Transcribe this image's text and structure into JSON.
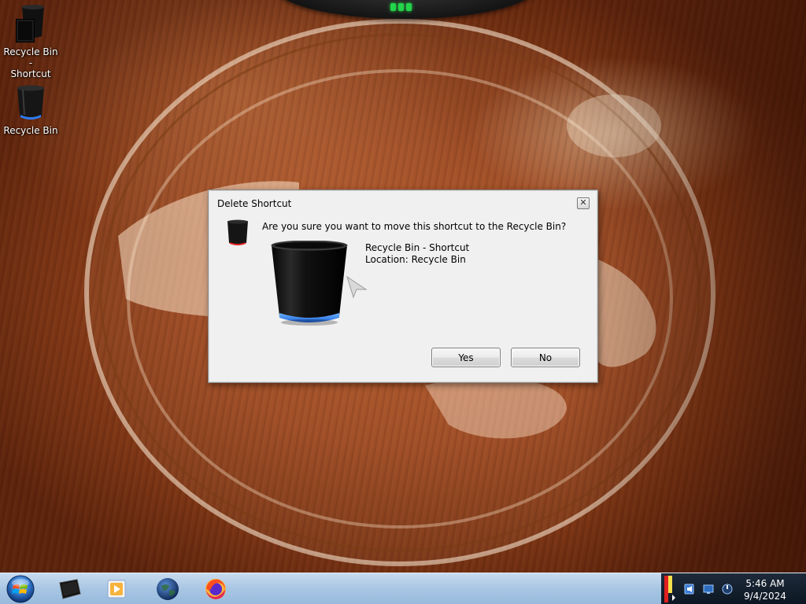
{
  "desktop": {
    "icons": [
      {
        "label_line1": "Recycle Bin -",
        "label_line2": "Shortcut",
        "icon": "recycle-bin-shortcut-icon"
      },
      {
        "label_line1": "Recycle Bin",
        "icon": "recycle-bin-icon"
      }
    ]
  },
  "dialog": {
    "title": "Delete Shortcut",
    "close_symbol": "✕",
    "question": "Are you sure you want to move this shortcut to the Recycle Bin?",
    "item_name": "Recycle Bin - Shortcut",
    "item_location": "Location: Recycle Bin",
    "yes_label": "Yes",
    "no_label": "No"
  },
  "taskbar": {
    "items": [
      "start-orb-icon",
      "desktop-icon",
      "media-player-icon",
      "globe-icon",
      "firefox-icon"
    ],
    "tray_icons": [
      "volume-icon",
      "network-icon",
      "display-icon",
      "power-icon"
    ],
    "time": "5:46 AM",
    "date": "9/4/2024"
  },
  "colors": {
    "accent_blue": "#2f7cf0",
    "tray_flag_red": "#e02020",
    "tray_flag_yellow": "#f4e04a"
  }
}
